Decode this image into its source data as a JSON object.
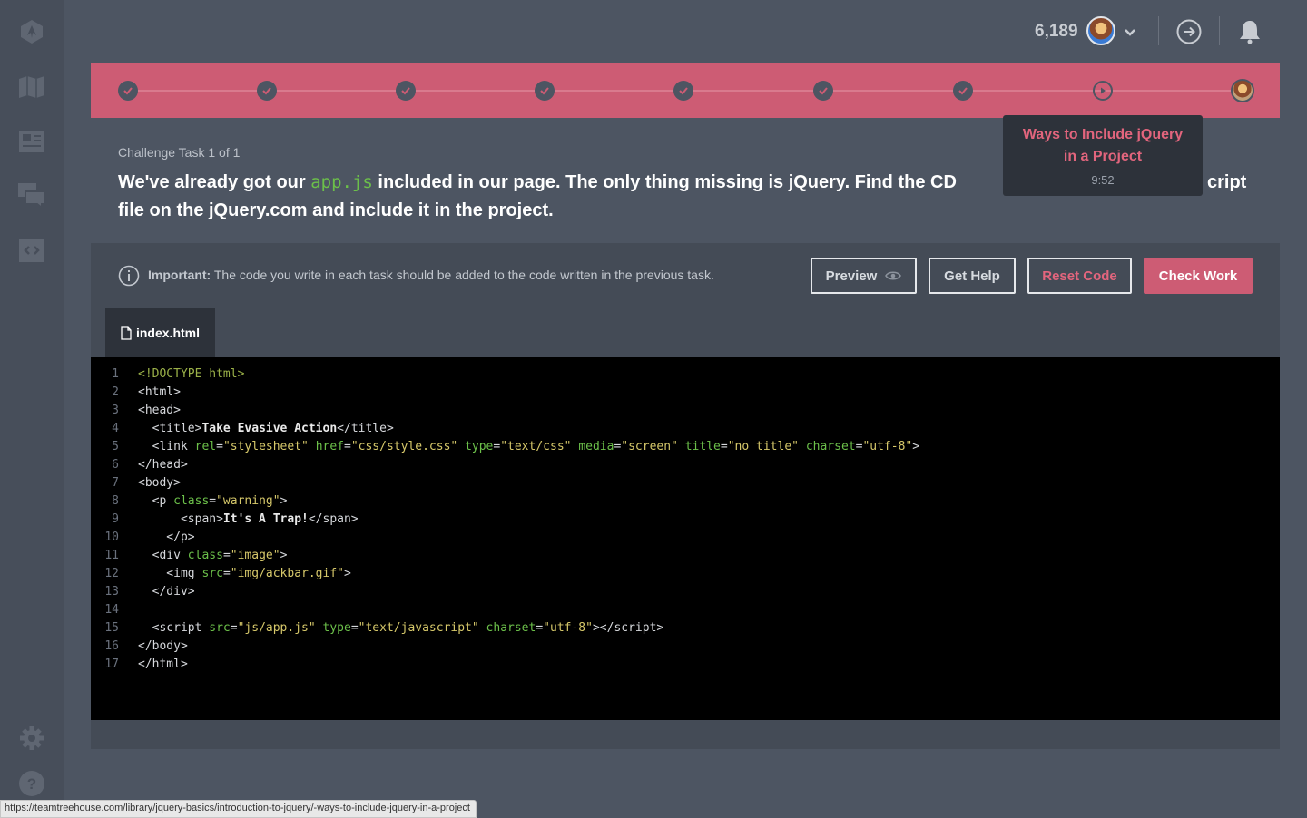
{
  "header": {
    "points": "6,189",
    "icons": [
      "avatar",
      "chevron-down-icon",
      "exit-icon",
      "bell-icon"
    ]
  },
  "sidebar": {
    "items": [
      "treehouse-logo-icon",
      "map-icon",
      "library-icon",
      "community-icon",
      "workspaces-icon",
      "settings-icon",
      "help-icon"
    ]
  },
  "progress": {
    "completed_steps": 7,
    "current_step": 8,
    "total_steps": 9
  },
  "tooltip": {
    "title": "Ways to Include jQuery in a Project",
    "time": "9:52"
  },
  "challenge": {
    "label": "Challenge Task 1 of 1",
    "text_before": "We've already got our ",
    "code_inline": "app.js",
    "text_after_visible": " included in our page. The only thing missing is jQuery. Find the CD",
    "text_right_visible": "cript",
    "text_line2": "file on the jQuery.com and include it in the project."
  },
  "toolbar": {
    "note_strong": "Important:",
    "note_text": " The code you write in each task should be added to the code written in the previous task.",
    "preview_label": "Preview",
    "help_label": "Get Help",
    "reset_label": "Reset Code",
    "check_label": "Check Work"
  },
  "editor": {
    "tab_label": "index.html",
    "line_numbers": [
      "1",
      "2",
      "3",
      "4",
      "5",
      "6",
      "7",
      "8",
      "9",
      "10",
      "11",
      "12",
      "13",
      "14",
      "15",
      "16",
      "17"
    ]
  },
  "status_url": "https://teamtreehouse.com/library/jquery-basics/introduction-to-jquery/-ways-to-include-jquery-in-a-project",
  "colors": {
    "accent": "#cd5c74",
    "background": "#4d5562",
    "code_green": "#6cc04a",
    "code_string": "#d6c86a"
  }
}
